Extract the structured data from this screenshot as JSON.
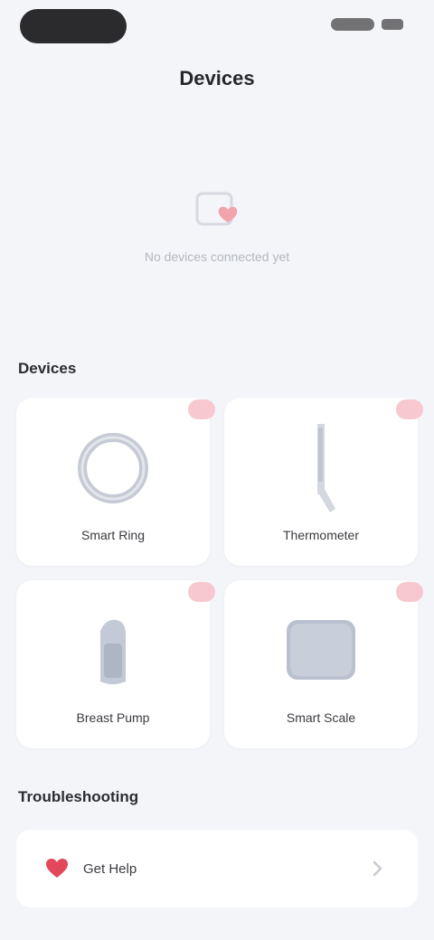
{
  "header": {
    "title": "Devices"
  },
  "empty_state": {
    "message": "No devices connected yet"
  },
  "sections": {
    "devices_title": "Devices",
    "troubleshooting_title": "Troubleshooting"
  },
  "devices": [
    {
      "label": "Smart Ring",
      "badge": ""
    },
    {
      "label": "Thermometer",
      "badge": ""
    },
    {
      "label": "Breast Pump",
      "badge": ""
    },
    {
      "label": "Smart Scale",
      "badge": ""
    }
  ],
  "troubleshooting": {
    "item_label": "Get Help"
  },
  "colors": {
    "accent": "#e2475a",
    "background": "#f4f5f8",
    "card": "#ffffff"
  }
}
